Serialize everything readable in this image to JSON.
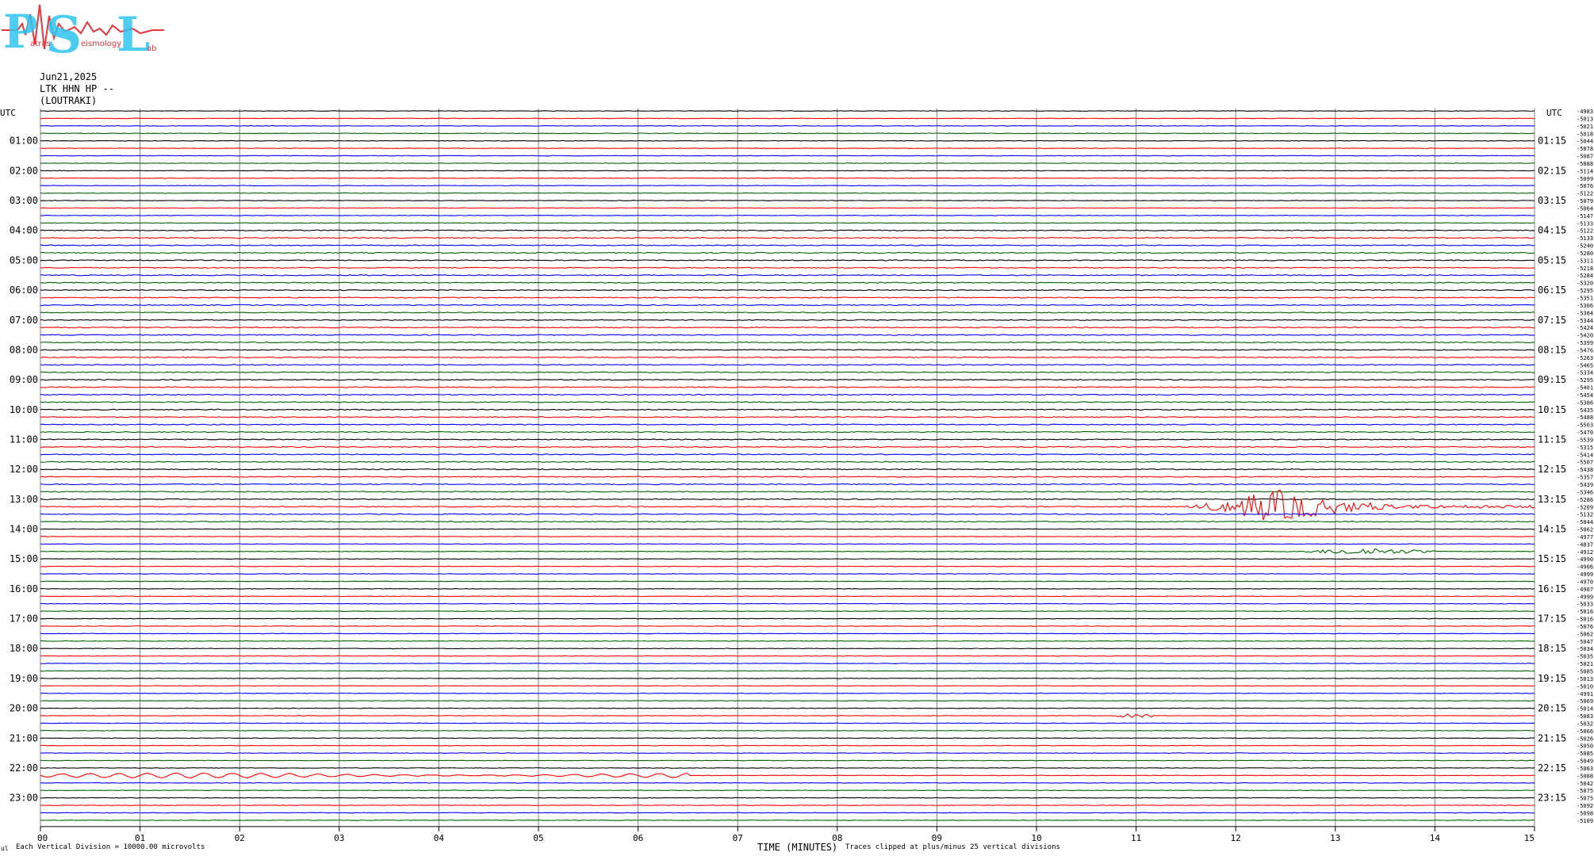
{
  "logo": {
    "letters": [
      "P",
      "S",
      "L"
    ],
    "small_texts": [
      "atras",
      "eismology",
      "ab"
    ],
    "colors": {
      "letters": "#2ec4f0",
      "wave": "#e8363c"
    }
  },
  "header": {
    "date": "Jun21,2025",
    "channel": "LTK HHN HP --",
    "station": "(LOUTRAKI)"
  },
  "axes": {
    "left_label": "UTC",
    "right_label": "UTC",
    "xlabel": "TIME (MINUTES)",
    "x_ticks": [
      "00",
      "01",
      "02",
      "03",
      "04",
      "05",
      "06",
      "07",
      "08",
      "09",
      "10",
      "11",
      "12",
      "13",
      "14",
      "15"
    ],
    "left_hours": [
      "01:00",
      "02:00",
      "03:00",
      "04:00",
      "05:00",
      "06:00",
      "07:00",
      "08:00",
      "09:00",
      "10:00",
      "11:00",
      "12:00",
      "13:00",
      "14:00",
      "15:00",
      "16:00",
      "17:00",
      "18:00",
      "19:00",
      "20:00",
      "21:00",
      "22:00",
      "23:00"
    ],
    "right_hours": [
      "01:15",
      "02:15",
      "03:15",
      "04:15",
      "05:15",
      "06:15",
      "07:15",
      "08:15",
      "09:15",
      "10:15",
      "11:15",
      "12:15",
      "13:15",
      "14:15",
      "15:15",
      "16:15",
      "17:15",
      "18:15",
      "19:15",
      "20:15",
      "21:15",
      "22:15",
      "23:15"
    ]
  },
  "footer": {
    "corner_mark": "ul",
    "division_note": "Each Vertical Division = 10000.00 microvolts",
    "clip_note": "Traces clipped at plus/minus 25 vertical divisions"
  },
  "chart_data": {
    "type": "line",
    "title": "Jun21,2025 LTK HHN HP -- (LOUTRAKI)",
    "xlabel": "TIME (MINUTES)",
    "xlim": [
      0,
      15
    ],
    "trace_count": 96,
    "minutes_per_trace": 15,
    "trace_color_cycle": [
      "#000000",
      "#ff0000",
      "#0000ff",
      "#006400"
    ],
    "grid_color": "#808080",
    "offset_labels": [
      "-4983",
      "-5013",
      "-5021",
      "-5018",
      "-5044",
      "-5078",
      "-5087",
      "-5088",
      "-5114",
      "-5099",
      "-5076",
      "-5122",
      "-5079",
      "-5064",
      "-5147",
      "-5133",
      "-5122",
      "-5133",
      "-5240",
      "-5280",
      "-5311",
      "-5218",
      "-5284",
      "-5320",
      "-5295",
      "-5351",
      "-5306",
      "-5384",
      "-5344",
      "-5424",
      "-5420",
      "-5399",
      "-5476",
      "-5263",
      "-5465",
      "-5334",
      "-5295",
      "-5401",
      "-5454",
      "-5386",
      "-5435",
      "-5488",
      "-5503",
      "-5470",
      "-5539",
      "-5315",
      "-5414",
      "-5507",
      "-5438",
      "-5357",
      "-5439",
      "-5346",
      "-5286",
      "-5209",
      "-5132",
      "-5044",
      "-5062",
      "-4977",
      "-4837",
      "-4912",
      "-4990",
      "-4906",
      "-4999",
      "-4970",
      "-4907",
      "-4999",
      "-5033",
      "-5016",
      "-5016",
      "-5076",
      "-5062",
      "-5047",
      "-5034",
      "-5035",
      "-5021",
      "-5085",
      "-5013",
      "-5010",
      "-4991",
      "-5069",
      "-5014",
      "-5083",
      "-5032",
      "-5066",
      "-5026",
      "-5050",
      "-5085",
      "-5049",
      "-5063",
      "-5088",
      "-5042",
      "-5075",
      "-5075",
      "-5092",
      "-5098",
      "-5109"
    ],
    "events": [
      {
        "trace": 53,
        "start_min": 11.5,
        "end_min": 15.0,
        "peak_min": 12.45,
        "peak_divisions": 2.2,
        "color": "#ff0000"
      },
      {
        "trace": 59,
        "start_min": 12.5,
        "end_min": 14.0,
        "peak_min": 13.3,
        "peak_divisions": 0.5,
        "color": "#006400"
      },
      {
        "trace": 81,
        "start_min": 10.7,
        "end_min": 11.2,
        "peak_min": 10.95,
        "peak_divisions": 0.25,
        "color": "#ff0000"
      },
      {
        "trace": 89,
        "start_min": 0.0,
        "end_min": 6.5,
        "peak_min": 3.5,
        "peak_divisions": 0.35,
        "color": "#ff0000"
      }
    ]
  }
}
